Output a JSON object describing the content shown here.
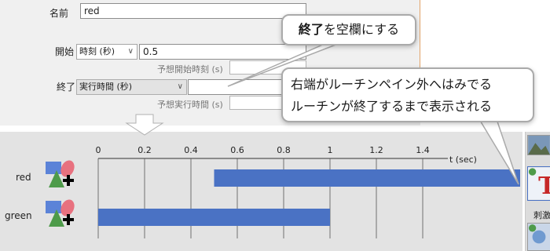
{
  "form": {
    "name_label": "名前",
    "name_value": "red",
    "start_label": "開始",
    "start_unit": "時刻 (秒)",
    "start_value": "0.5",
    "expected_start_label": "予想開始時刻 (s)",
    "end_label": "終了",
    "end_unit": "実行時間 (秒)",
    "end_value": "",
    "expected_duration_label": "予想実行時間 (s)"
  },
  "callouts": {
    "top_bold": "終了",
    "top_rest": "を空欄にする",
    "right_line1": "右端がルーチンペイン外へはみでる",
    "right_line2": "ルーチンが終了するまで表示される"
  },
  "timeline": {
    "axis_unit": "t (sec)",
    "ticks": [
      "0",
      "0.2",
      "0.4",
      "0.6",
      "0.8",
      "1",
      "1.2",
      "1.4"
    ],
    "tick_values": [
      0,
      0.2,
      0.4,
      0.6,
      0.8,
      1.0,
      1.2,
      1.4
    ],
    "rows": [
      {
        "label": "red",
        "start": 0.5,
        "end": null
      },
      {
        "label": "green",
        "start": 0.0,
        "end": 1.0
      }
    ],
    "bar_color": "#4a72c4"
  },
  "right_panel": {
    "label": "刺激"
  },
  "colors": {
    "callout_border": "#aaaaaa",
    "dialog_bg": "#f0f0f0",
    "timeline_bg": "#e3e3e3",
    "icon_blue": "#5b83d8",
    "icon_pink": "#e8717f",
    "icon_green": "#4e9b4a"
  },
  "icons": [
    "down-arrow-icon",
    "component-shapes-icon",
    "chevron-down-icon"
  ]
}
